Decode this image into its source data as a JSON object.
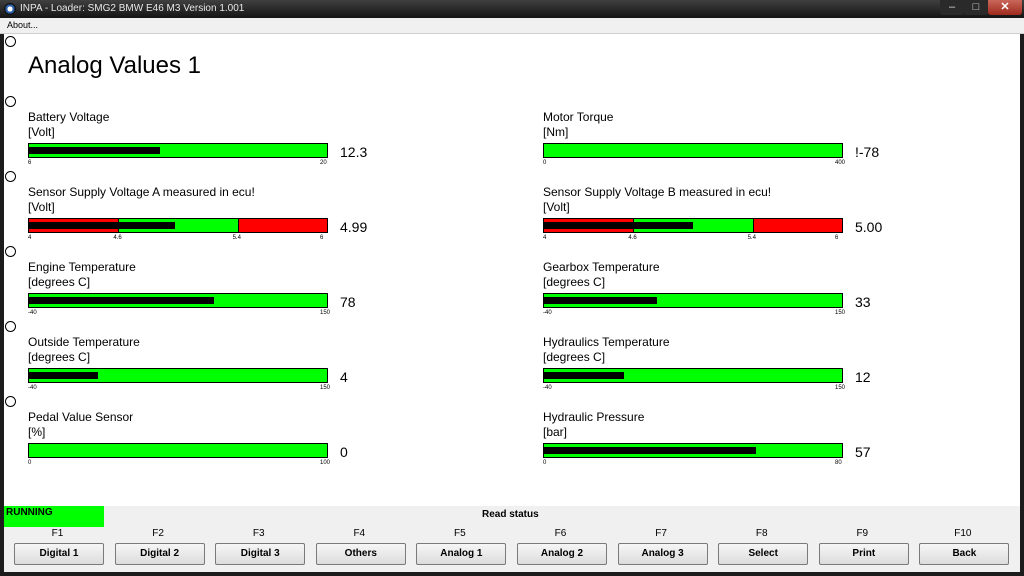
{
  "window": {
    "title": "INPA - Loader:  SMG2 BMW E46 M3 Version 1.001",
    "minimize": "–",
    "maximize": "□",
    "close": "✕"
  },
  "menu": {
    "about": "About..."
  },
  "page": {
    "title": "Analog Values 1"
  },
  "panels": [
    {
      "name": "Battery Voltage",
      "unit": "[Volt]",
      "value": "12.3",
      "fill": 0.44,
      "scale": [
        "6",
        "20"
      ]
    },
    {
      "name": "Motor Torque",
      "unit": "[Nm]",
      "value": "!-78",
      "fill": 0,
      "scale": [
        "0",
        "400"
      ]
    },
    {
      "name": "Sensor Supply Voltage A  measured in ecu!",
      "unit": "[Volt]",
      "value": "4.99",
      "fill": 0.49,
      "scale": [
        "4",
        "4.6",
        "5.4",
        "6"
      ],
      "red_ranges": [
        [
          0,
          0.3
        ],
        [
          0.7,
          1
        ]
      ]
    },
    {
      "name": "Sensor Supply Voltage B  measured in ecu!",
      "unit": "[Volt]",
      "value": "5.00",
      "fill": 0.5,
      "scale": [
        "4",
        "4.6",
        "5.4",
        "6"
      ],
      "red_ranges": [
        [
          0,
          0.3
        ],
        [
          0.7,
          1
        ]
      ]
    },
    {
      "name": "Engine Temperature",
      "unit": "[degrees C]",
      "value": "78",
      "fill": 0.62,
      "scale": [
        "-40",
        "150"
      ]
    },
    {
      "name": "Gearbox Temperature",
      "unit": "[degrees C]",
      "value": "33",
      "fill": 0.38,
      "scale": [
        "-40",
        "150"
      ]
    },
    {
      "name": "Outside Temperature",
      "unit": "[degrees C]",
      "value": "4",
      "fill": 0.23,
      "scale": [
        "-40",
        "150"
      ]
    },
    {
      "name": "Hydraulics Temperature",
      "unit": "[degrees C]",
      "value": "12",
      "fill": 0.27,
      "scale": [
        "-40",
        "150"
      ]
    },
    {
      "name": "Pedal Value Sensor",
      "unit": "[%]",
      "value": "0",
      "fill": 0,
      "scale": [
        "0",
        "100"
      ]
    },
    {
      "name": "Hydraulic Pressure",
      "unit": "[bar]",
      "value": "57",
      "fill": 0.71,
      "scale": [
        "0",
        "80"
      ]
    }
  ],
  "status": {
    "state": "RUNNING",
    "label": "Read status"
  },
  "function_keys": [
    {
      "key": "F1",
      "label": "Digital 1"
    },
    {
      "key": "F2",
      "label": "Digital 2"
    },
    {
      "key": "F3",
      "label": "Digital 3"
    },
    {
      "key": "F4",
      "label": "Others"
    },
    {
      "key": "F5",
      "label": "Analog 1"
    },
    {
      "key": "F6",
      "label": "Analog 2"
    },
    {
      "key": "F7",
      "label": "Analog 3"
    },
    {
      "key": "F8",
      "label": "Select"
    },
    {
      "key": "F9",
      "label": "Print"
    },
    {
      "key": "F10",
      "label": "Back"
    }
  ],
  "colors": {
    "ok": "#00ff00",
    "alarm": "#ff0000",
    "level": "#000000"
  }
}
